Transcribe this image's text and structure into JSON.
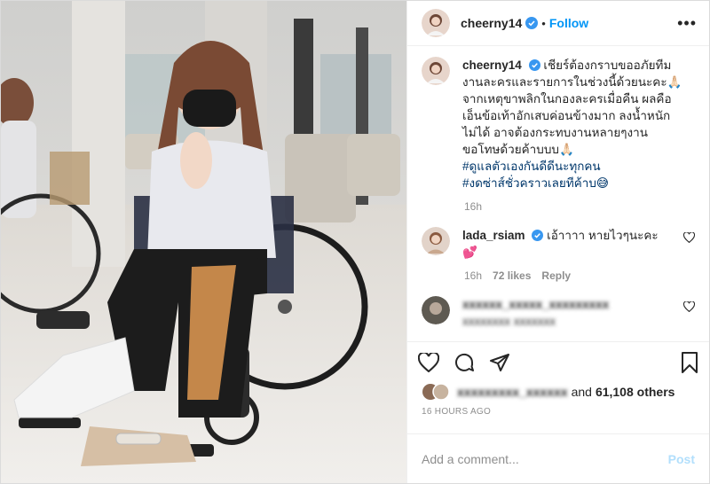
{
  "post": {
    "author": "cheerny14",
    "follow_label": "Follow",
    "dot": "•",
    "more_glyph": "•••"
  },
  "caption": {
    "author": "cheerny14",
    "lines": [
      "เชียร์ต้องกราบขออภัยทีม",
      "งานละครและรายการในช่วงนี้ด้วยนะคะ🙏🏻",
      "จากเหตุขาพลิกในกองละครเมื่อคืน ผลคือ",
      "เอ็นข้อเท้าอักเสบค่อนข้างมาก ลงน้ำหนัก",
      "ไม่ได้ อาจต้องกระทบงานหลายๆงาน",
      "ขอโทษด้วยค้าบบบ🙏🏻"
    ],
    "hashtag1": "#ดูแลตัวเองกันดีดีนะทุกคน",
    "hashtag2": "#งดซ่าส์ชั่วคราวเลยทีค้าบ😅",
    "time": "16h"
  },
  "comment1": {
    "author": "lada_rsiam",
    "text": "เอ้าาาา หายไวๆนะคะ",
    "emoji": "💕",
    "time": "16h",
    "likes": "72 likes",
    "reply": "Reply"
  },
  "comment2": {
    "author_blurred": "xxxxxx_xxxxx_xxxxxxxxx",
    "text_blurred": "xxxxxxxx xxxxxxx"
  },
  "likes": {
    "blurred_name": "xxxxxxxxx_xxxxxx",
    "and": "and",
    "count": "61,108 others"
  },
  "ago": "16 HOURS AGO",
  "comment_input": {
    "placeholder": "Add a comment...",
    "post_label": "Post"
  },
  "colors": {
    "link_blue": "#0095f6",
    "hashtag": "#00376b",
    "muted": "#8e8e8e",
    "post_disabled": "#b2dffc",
    "verified": "#3897f0"
  },
  "icons": [
    "more-icon",
    "verified-badge-icon",
    "heart-icon",
    "comment-icon",
    "share-icon",
    "bookmark-icon"
  ]
}
